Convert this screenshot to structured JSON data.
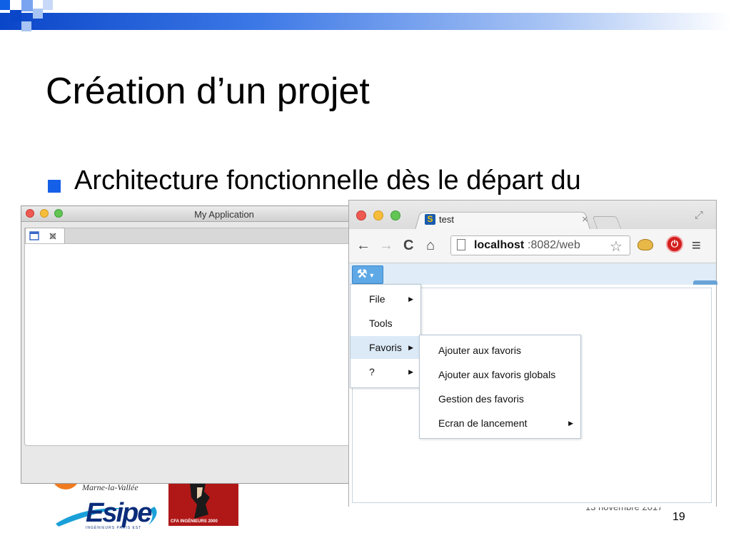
{
  "slide": {
    "title": "Création d’un projet",
    "bullet": "Architecture fonctionnelle dès le départ du",
    "page_number": "19",
    "date_partial": "13 novembre 2017",
    "logos": {
      "marne": "Marne-la-Vallée",
      "esipe": "Esipe",
      "esipe_sub": "INGÉNIEURS PARIS EST",
      "cfa": "CFA INGÉNIEURS 2000"
    }
  },
  "left_window": {
    "title": "My Application"
  },
  "browser": {
    "tab_title": "test",
    "favicon_letter": "S",
    "url_host": "localhost",
    "url_rest": ":8082/web",
    "icons": [
      "back-icon",
      "forward-icon",
      "reload-icon",
      "home-icon",
      "star-icon",
      "cookie-icon",
      "stop-icon",
      "menu-icon"
    ]
  },
  "app": {
    "menu": [
      {
        "label": "File",
        "submenu": true
      },
      {
        "label": "Tools",
        "submenu": false
      },
      {
        "label": "Favoris",
        "submenu": true,
        "active": true
      },
      {
        "label": "?",
        "submenu": true
      }
    ],
    "favoris_submenu": [
      {
        "label": "Ajouter aux favoris",
        "submenu": false
      },
      {
        "label": "Ajouter aux favoris globals",
        "submenu": false
      },
      {
        "label": "Gestion des favoris",
        "submenu": false
      },
      {
        "label": "Ecran de lancement",
        "submenu": true
      }
    ]
  },
  "colors": {
    "bullet": "#1560e8",
    "menu_active": "#dce9f6",
    "tools_button": "#5ea8e6"
  }
}
